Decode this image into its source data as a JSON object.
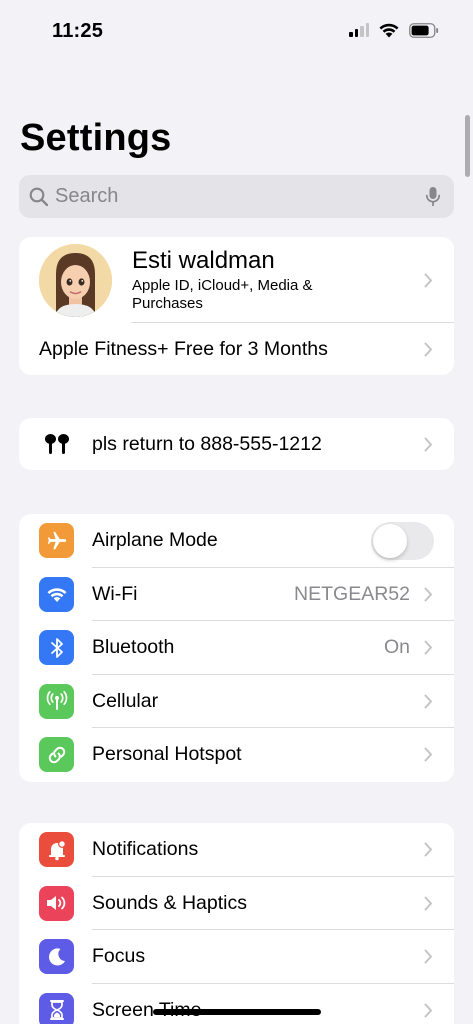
{
  "status_bar": {
    "time": "11:25",
    "battery_percent": 75
  },
  "title": "Settings",
  "search": {
    "placeholder": "Search"
  },
  "profile": {
    "name": "Esti waldman",
    "subtitle": "Apple ID, iCloud+, Media & Purchases",
    "promo": "Apple Fitness+ Free for 3 Months"
  },
  "airpods": {
    "label": "pls return to 888-555-1212"
  },
  "connectivity": [
    {
      "label": "Airplane Mode",
      "icon": "airplane-icon",
      "color": "#f19a37",
      "toggle": false
    },
    {
      "label": "Wi-Fi",
      "icon": "wifi-icon",
      "color": "#3478f6",
      "value": "NETGEAR52"
    },
    {
      "label": "Bluetooth",
      "icon": "bluetooth-icon",
      "color": "#3478f6",
      "value": "On"
    },
    {
      "label": "Cellular",
      "icon": "cellular-icon",
      "color": "#5ac85a"
    },
    {
      "label": "Personal Hotspot",
      "icon": "hotspot-icon",
      "color": "#5ac85a"
    }
  ],
  "notifications_group": [
    {
      "label": "Notifications",
      "icon": "notifications-icon",
      "color": "#eb4d3d"
    },
    {
      "label": "Sounds & Haptics",
      "icon": "sounds-icon",
      "color": "#eb445a"
    },
    {
      "label": "Focus",
      "icon": "focus-moon-icon",
      "color": "#5e5ce6"
    },
    {
      "label": "Screen Time",
      "icon": "screen-time-icon",
      "color": "#5e5ce6"
    }
  ]
}
